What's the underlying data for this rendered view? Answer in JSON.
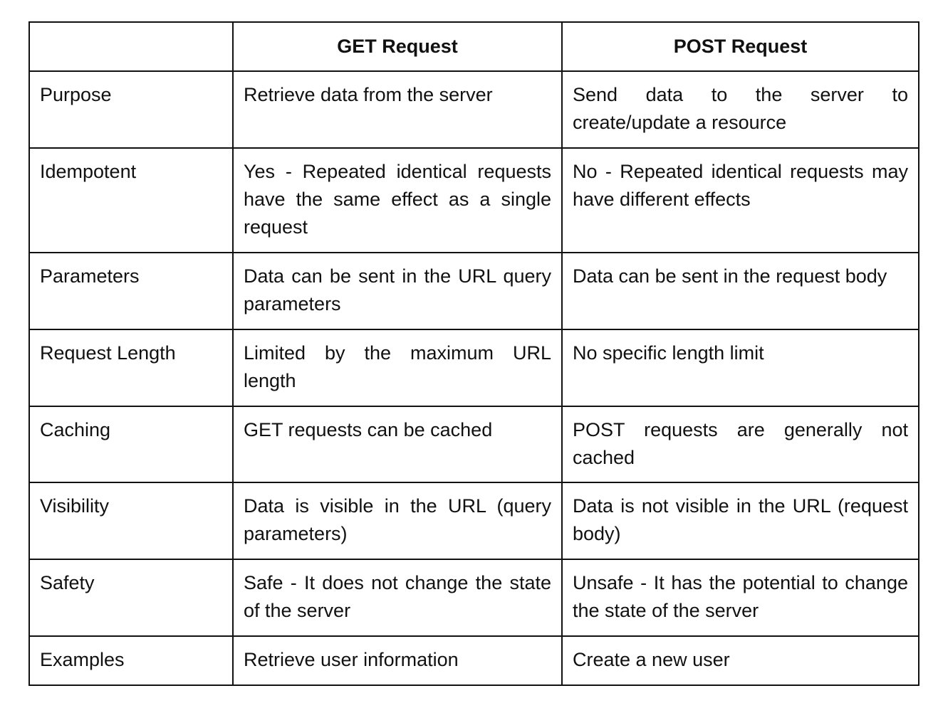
{
  "table": {
    "headers": [
      "",
      "GET Request",
      "POST Request"
    ],
    "rows": [
      {
        "label": "Purpose",
        "get": "Retrieve data from the server",
        "post": "Send data to the server to create/update a resource"
      },
      {
        "label": "Idempotent",
        "get": "Yes - Repeated identical requests have the same effect as a single request",
        "post": "No - Repeated identical requests may have different effects"
      },
      {
        "label": "Parameters",
        "get": "Data can be sent in the URL query parameters",
        "post": "Data can be sent in the request body"
      },
      {
        "label": "Request Length",
        "get": "Limited by the maximum URL length",
        "post": "No specific length limit"
      },
      {
        "label": "Caching",
        "get": "GET requests can be cached",
        "post": "POST requests are generally not cached"
      },
      {
        "label": "Visibility",
        "get": "Data is visible in the URL (query parameters)",
        "post": "Data is not visible in the URL (request body)"
      },
      {
        "label": "Safety",
        "get": "Safe - It does not change the state of the server",
        "post": "Unsafe - It has the potential to change the state of the server"
      },
      {
        "label": "Examples",
        "get": "Retrieve user information",
        "post": "Create a new user"
      }
    ]
  }
}
